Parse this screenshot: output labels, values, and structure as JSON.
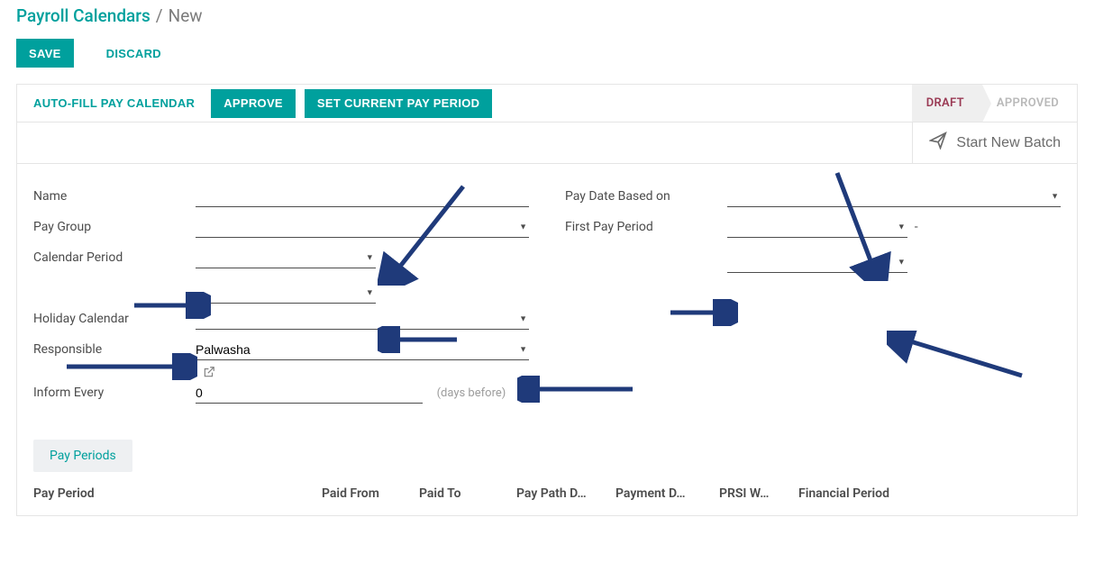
{
  "breadcrumb": {
    "root": "Payroll Calendars",
    "sep": "/",
    "current": "New"
  },
  "buttons": {
    "save": "SAVE",
    "discard": "DISCARD"
  },
  "statusbar": {
    "autofill": "AUTO-FILL PAY CALENDAR",
    "approve": "APPROVE",
    "setcurrent": "SET CURRENT PAY PERIOD",
    "draft": "DRAFT",
    "approved": "APPROVED"
  },
  "stat": {
    "startbatch": "Start New Batch"
  },
  "labels": {
    "name": "Name",
    "paygroup": "Pay Group",
    "calendarperiod": "Calendar Period",
    "holidaycalendar": "Holiday Calendar",
    "responsible": "Responsible",
    "informevery": "Inform Every",
    "paydatebased": "Pay Date Based on",
    "firstpayperiod": "First Pay Period"
  },
  "values": {
    "name": "",
    "paygroup": "",
    "calperiod1": "",
    "calperiod2": "",
    "calperiod3": "",
    "holidaycalendar": "",
    "responsible": "Palwasha",
    "informevery": "0",
    "informhint": "(days before)",
    "paydatebased": "",
    "firstA": "",
    "firstB": "",
    "firstC": ""
  },
  "tabs": {
    "payperiods": "Pay Periods"
  },
  "columns": {
    "payperiod": "Pay Period",
    "paidfrom": "Paid From",
    "paidto": "Paid To",
    "paypathd": "Pay Path D…",
    "paymentd": "Payment D…",
    "prsiw": "PRSI W…",
    "finperiod": "Financial Period"
  }
}
